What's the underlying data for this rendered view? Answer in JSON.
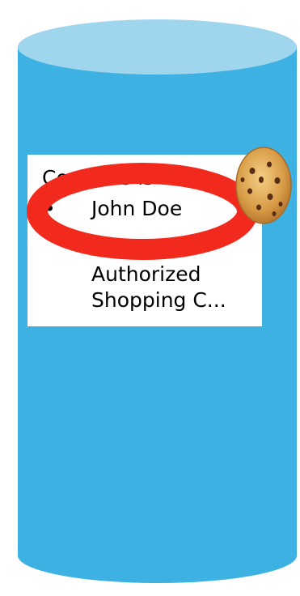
{
  "colors": {
    "cylinder_body": "#3db1e2",
    "cylinder_top": "#9fd6ee",
    "highlight_ring": "#f2291d",
    "card_background": "#ffffff",
    "text": "#000000"
  },
  "card": {
    "title": "Cookie C is for:",
    "bullet_symbol": "•",
    "items": [
      {
        "text": "John Doe"
      },
      {
        "text": "Authorized Shopping C..."
      }
    ]
  },
  "icons": {
    "cookie": "cookie-icon"
  }
}
